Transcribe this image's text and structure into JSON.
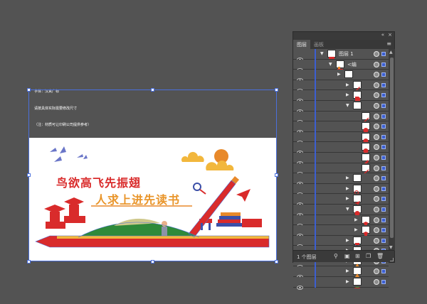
{
  "canvas": {
    "notes": [
      "字体：汉真广标",
      "请按具体实际需要修改尺寸",
      "（注：材质可让印刷公司提供参考）"
    ],
    "artwork": {
      "title_line1": "鸟欲高飞先振翅",
      "title_line2": "人求上进先读书"
    }
  },
  "layers_panel": {
    "tabs": [
      "图层",
      "画板"
    ],
    "active_tab": "图层",
    "collapse_icon": "double-chevron-icon",
    "close_icon": "close-icon",
    "menu_icon": "menu-icon",
    "rows": [
      {
        "name": "图层 1",
        "indent": 0,
        "expanded": true,
        "thumb": "layer",
        "selected": true
      },
      {
        "name": "<编",
        "indent": 1,
        "expanded": true,
        "thumb": "group",
        "selected": true
      },
      {
        "name": "",
        "indent": 2,
        "expanded": false,
        "thumb": "none",
        "selected": true
      },
      {
        "name": "",
        "indent": 3,
        "expanded": false,
        "thumb": "pen",
        "selected": true
      },
      {
        "name": "",
        "indent": 3,
        "expanded": false,
        "thumb": "page",
        "selected": true
      },
      {
        "name": "",
        "indent": 3,
        "expanded": true,
        "thumb": "none",
        "selected": true
      },
      {
        "name": "",
        "indent": 4,
        "expanded": null,
        "thumb": "slash",
        "selected": true
      },
      {
        "name": "",
        "indent": 4,
        "expanded": null,
        "thumb": "red-dot",
        "selected": true
      },
      {
        "name": "",
        "indent": 4,
        "expanded": null,
        "thumb": "red-dot",
        "selected": true
      },
      {
        "name": "",
        "indent": 4,
        "expanded": null,
        "thumb": "red-dot",
        "selected": true
      },
      {
        "name": "",
        "indent": 4,
        "expanded": null,
        "thumb": "pen-tip",
        "selected": true
      },
      {
        "name": "",
        "indent": 4,
        "expanded": null,
        "thumb": "slash",
        "selected": true
      },
      {
        "name": "",
        "indent": 3,
        "expanded": false,
        "thumb": "none",
        "selected": true
      },
      {
        "name": "",
        "indent": 3,
        "expanded": false,
        "thumb": "magnifier",
        "selected": true
      },
      {
        "name": "",
        "indent": 3,
        "expanded": false,
        "thumb": "plane",
        "selected": true
      },
      {
        "name": "",
        "indent": 3,
        "expanded": true,
        "thumb": "red-dot",
        "selected": true
      },
      {
        "name": "",
        "indent": 4,
        "expanded": false,
        "thumb": "cap",
        "selected": true
      },
      {
        "name": "",
        "indent": 4,
        "expanded": false,
        "thumb": "cap",
        "selected": true
      },
      {
        "name": "",
        "indent": 3,
        "expanded": false,
        "thumb": "chair",
        "selected": true
      },
      {
        "name": "",
        "indent": 3,
        "expanded": false,
        "thumb": "dots",
        "selected": true
      },
      {
        "name": "",
        "indent": 3,
        "expanded": false,
        "thumb": "orange",
        "selected": true
      },
      {
        "name": "",
        "indent": 3,
        "expanded": false,
        "thumb": "orange",
        "selected": true
      },
      {
        "name": "",
        "indent": 3,
        "expanded": false,
        "thumb": "hill",
        "selected": true
      }
    ],
    "footer": {
      "count": "1 个图层",
      "buttons": [
        "search-icon",
        "make-clipping-mask-icon",
        "new-sublayer-icon",
        "new-layer-icon",
        "delete-icon"
      ]
    },
    "selection_color": "#3c5fd1"
  }
}
